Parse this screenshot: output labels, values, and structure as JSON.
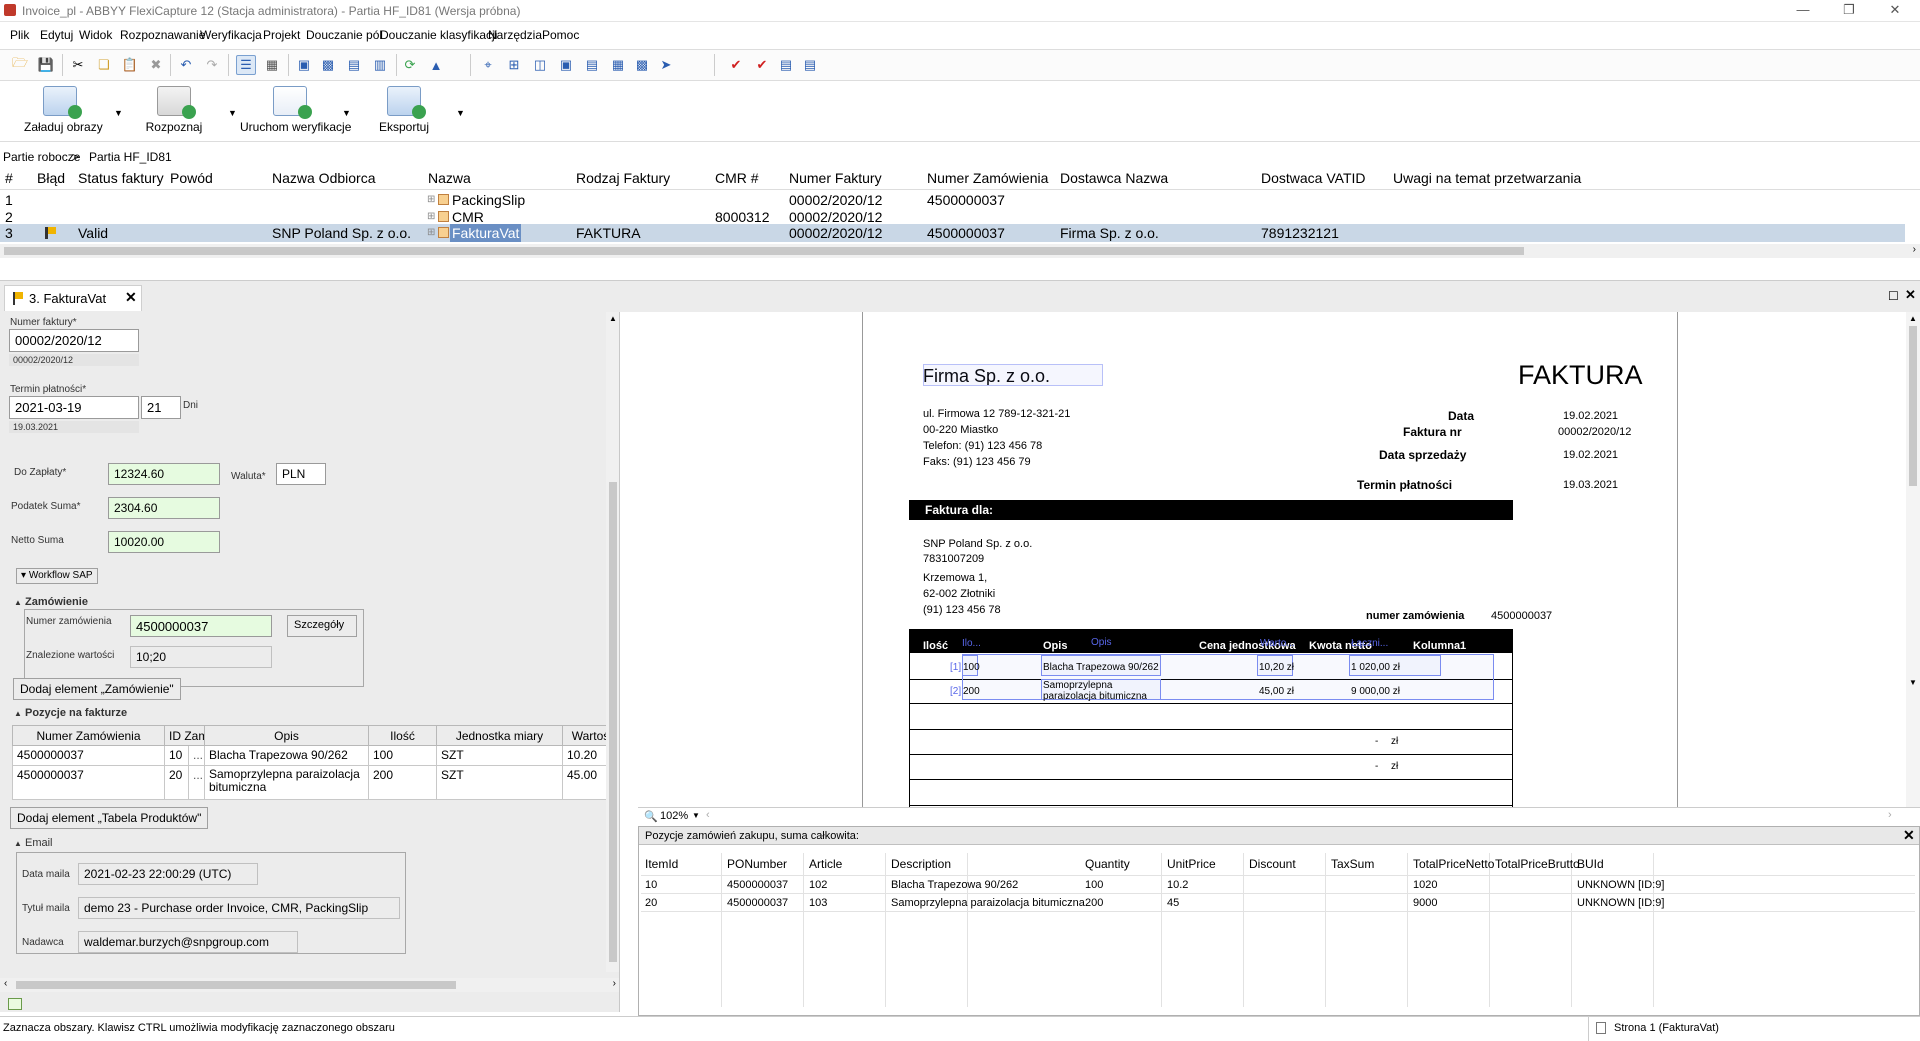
{
  "window": {
    "title": "Invoice_pl - ABBYY FlexiCapture 12 (Stacja administratora) - Partia HF_ID81 (Wersja próbna)"
  },
  "menu": [
    "Plik",
    "Edytuj",
    "Widok",
    "Rozpoznawanie",
    "Weryfikacja",
    "Projekt",
    "Douczanie pól",
    "Douczanie klasyfikacji",
    "Narzędzia",
    "Pomoc"
  ],
  "ribbon": {
    "load": "Załaduj obrazy",
    "recognize": "Rozpoznaj",
    "verify": "Uruchom weryfikacje",
    "export": "Eksportuj"
  },
  "breadcrumb": {
    "root": "Partie robocze",
    "sep": ">",
    "batch": "Partia HF_ID81"
  },
  "grid": {
    "headers": [
      "#",
      "Błąd",
      "Status faktury",
      "Powód",
      "Nazwa Odbiorca",
      "Nazwa",
      "Rodzaj Faktury",
      "CMR #",
      "Numer Faktury",
      "Numer Zamówienia",
      "Dostawca Nazwa",
      "Dostwaca VATID",
      "Uwagi na temat przetwarzania"
    ],
    "rows": [
      {
        "n": "1",
        "status": "",
        "odbiorca": "",
        "nazwa": "PackingSlip",
        "rodzaj": "",
        "cmr": "",
        "faktura": "00002/2020/12",
        "zamowienie": "4500000037",
        "dostawca": "",
        "vatid": ""
      },
      {
        "n": "2",
        "status": "",
        "odbiorca": "",
        "nazwa": "CMR",
        "rodzaj": "",
        "cmr": "8000312",
        "faktura": "00002/2020/12",
        "zamowienie": "",
        "dostawca": "",
        "vatid": ""
      },
      {
        "n": "3",
        "status": "Valid",
        "odbiorca": "SNP Poland Sp. z o.o.",
        "nazwa": "FakturaVat",
        "rodzaj": "FAKTURA",
        "cmr": "",
        "faktura": "00002/2020/12",
        "zamowienie": "4500000037",
        "dostawca": "Firma Sp. z o.o.",
        "vatid": "7891232121"
      }
    ]
  },
  "tab": {
    "label": "3. FakturaVat"
  },
  "form": {
    "numer_faktury_label": "Numer faktury*",
    "numer_faktury": "00002/2020/12",
    "numer_faktury_rec": "00002/2020/12",
    "termin_label": "Termin płatności*",
    "termin": "2021-03-19",
    "dni": "21",
    "dni_label": "Dni",
    "termin_rec": "19.03.2021",
    "do_zaplaty_label": "Do Zapłaty*",
    "do_zaplaty": "12324.60",
    "waluta_label": "Waluta*",
    "waluta": "PLN",
    "podatek_label": "Podatek Suma*",
    "podatek": "2304.60",
    "netto_label": "Netto Suma",
    "netto": "10020.00",
    "workflow": "Workflow SAP",
    "zamowienie_section": "Zamówienie",
    "nr_zam_label": "Numer zamówienia",
    "nr_zam": "4500000037",
    "szczegoly": "Szczegóły",
    "znalezione_label": "Znalezione wartości",
    "znalezione": "10;20",
    "dodaj_zam": "Dodaj element „Zamówienie\"",
    "pozycje_section": "Pozycje na fakturze",
    "pozycje_headers": [
      "Numer Zamówienia",
      "ID Zam",
      "Opis",
      "Ilość",
      "Jednostka miary",
      "Wartoś"
    ],
    "pozycje": [
      {
        "nr": "4500000037",
        "id": "10",
        "dots": "...",
        "opis": "Blacha Trapezowa 90/262",
        "ilosc": "100",
        "jm": "SZT",
        "wart": "10.20"
      },
      {
        "nr": "4500000037",
        "id": "20",
        "dots": "...",
        "opis": "Samoprzylepna paraizolacja bitumiczna",
        "ilosc": "200",
        "jm": "SZT",
        "wart": "45.00"
      }
    ],
    "dodaj_tab": "Dodaj element „Tabela Produktów\"",
    "email_section": "Email",
    "data_maila_label": "Data maila",
    "data_maila": "2021-02-23 22:00:29 (UTC)",
    "tytul_label": "Tytuł maila",
    "tytul": "demo 23 - Purchase order Invoice, CMR, PackingSlip",
    "nadawca_label": "Nadawca",
    "nadawca": "waldemar.burzych@snpgroup.com"
  },
  "invoice": {
    "company": "Firma Sp. z o.o.",
    "doc_title": "FAKTURA",
    "address1": "ul. Firmowa 12  789-12-321-21",
    "address2": "00-220 Miastko",
    "phone": "Telefon: (91) 123 456 78",
    "fax": "Faks: (91) 123 456 79",
    "data_label": "Data",
    "data": "19.02.2021",
    "nr_label": "Faktura nr",
    "nr": "00002/2020/12",
    "sprzedaz_label": "Data sprzedaży",
    "sprzedaz": "19.02.2021",
    "termin_label": "Termin płatności",
    "termin": "19.03.2021",
    "faktura_dla": "Faktura dla:",
    "buyer1": "SNP Poland Sp. z o.o.",
    "buyer2": "7831007209",
    "buyer3": "Krzemowa 1,",
    "buyer4": "62-002 Złotniki",
    "buyer5": "(91) 123 456 78",
    "zam_label": "numer zamówienia",
    "zam": "4500000037",
    "th_ilosc": "Ilość",
    "th_opis": "Opis",
    "th_cena": "Cena jednostkowa",
    "th_kwota": "Kwota netto",
    "th_kol": "Kolumna1",
    "tag_ilo": "Ilo...",
    "tag_opis": "Opis",
    "tag_warto": "Warto...",
    "tag_laczn": "Łączni...",
    "r1_idx": "[1]",
    "r1_qty": "100",
    "r1_desc": "Blacha Trapezowa 90/262",
    "r1_price": "10,20 zł",
    "r1_sum": "1 020,00 zł",
    "r2_idx": "[2]",
    "r2_qty": "200",
    "r2_desc": "Samoprzylepna paraizolacja bitumiczna",
    "r2_price": "45,00 zł",
    "r2_sum": "9 000,00 zł",
    "dash": "-",
    "zl": "zł"
  },
  "zoom": "102%",
  "po_table": {
    "title": "Pozycje zamówień zakupu, suma całkowita:",
    "headers": [
      "ItemId",
      "PONumber",
      "Article",
      "Description",
      "Quantity",
      "UnitPrice",
      "Discount",
      "TaxSum",
      "TotalPriceNetto",
      "TotalPriceBrutto",
      "BUId"
    ],
    "rows": [
      [
        "10",
        "4500000037",
        "102",
        "Blacha Trapezowa 90/262",
        "100",
        "10.2",
        "",
        "",
        "1020",
        "",
        "UNKNOWN [ID:9]"
      ],
      [
        "20",
        "4500000037",
        "103",
        "Samoprzylepna paraizolacja bitumiczna",
        "200",
        "45",
        "",
        "",
        "9000",
        "",
        "UNKNOWN [ID:9]"
      ]
    ]
  },
  "status": {
    "left": "Zaznacza obszary. Klawisz CTRL umożliwia modyfikację zaznaczonego obszaru",
    "page": "Strona 1 (FakturaVat)"
  }
}
